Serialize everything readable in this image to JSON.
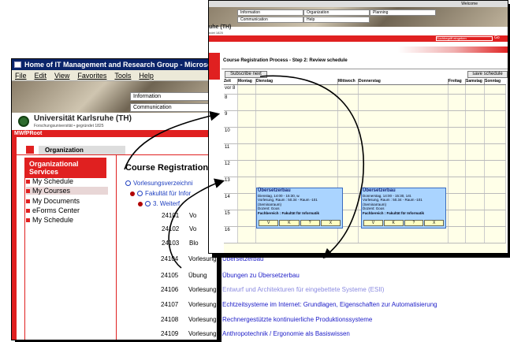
{
  "win_a": {
    "title": "Home of IT Management and Research Group - Microsoft Internet E",
    "menu": [
      "File",
      "Edit",
      "View",
      "Favorites",
      "Tools",
      "Help"
    ],
    "nav_fields": [
      "Information",
      "Communication"
    ],
    "university": "Universität Karlsruhe (TH)",
    "university_sub": "Forschungsuniversität • gegründet 1825",
    "root_label": "MWfPRoot",
    "sidebar_title": "Organization",
    "sidebar_section": "Organizational Services",
    "sidebar_items": [
      "My Schedule",
      "My Courses",
      "My Documents",
      "eForms Center",
      "My Schedule"
    ],
    "content_title": "Course Registration P",
    "tree": [
      "Vorlesungsverzeichni",
      "Fakultät für Infor",
      "3. Weiterf"
    ],
    "courses": [
      {
        "num": "24101",
        "type": "Vo",
        "title": ""
      },
      {
        "num": "24102",
        "type": "Vo",
        "title": ""
      },
      {
        "num": "24103",
        "type": "Blo",
        "title": ""
      },
      {
        "num": "24104",
        "type": "Vorlesung",
        "title": "Übersetzerbau"
      },
      {
        "num": "24105",
        "type": "Übung",
        "title": "Übungen zu Übersetzerbau"
      },
      {
        "num": "24106",
        "type": "Vorlesung",
        "title": "Entwurf und Architekturen für eingebettete Systeme (ESII)"
      },
      {
        "num": "24107",
        "type": "Vorlesung",
        "title": "Echtzeitsysteme im Internet: Grundlagen, Eigenschaften zur Automatisierung"
      },
      {
        "num": "24108",
        "type": "Vorlesung",
        "title": "Rechnergestützte kontinuierliche Produktionssysteme"
      },
      {
        "num": "24109",
        "type": "Vorlesung",
        "title": "Anthropotechnik / Ergonomie als Basiswissen"
      }
    ]
  },
  "win_b": {
    "nav_fields": [
      "Information",
      "Organization",
      "Planning",
      "Communication",
      "Help"
    ],
    "uni_short": "uhe (TH)",
    "uni_short_sub": "ndet 1825",
    "welcome": "Welcome",
    "search_placeholder": "Suchbegriff eingeben",
    "search_button": "Go",
    "heading": "Course Registration Process - Step 2: Review schedule",
    "subscribe_button": "Subscribe next",
    "save_button": "save schedule",
    "columns": [
      "Zeit",
      "Montag",
      "Dienstag",
      "Mittwoch",
      "Donnerstag",
      "Freitag",
      "Samstag",
      "Sonntag"
    ],
    "hours": [
      "vor 8",
      "8",
      "9",
      "10",
      "11",
      "12",
      "13",
      "14",
      "15",
      "16"
    ],
    "events": [
      {
        "title": "Übersetzerbau",
        "line1": "Dienstag, 14:00 - 15:30, w.",
        "line2": "Vorlesung, Raum : 50.34 - Raum -101",
        "line3": "(Seminarraum)",
        "line4": "Dozent: Goos",
        "line5": "Fachbereich : Fakultät für Informatik",
        "actions": [
          "V",
          "K",
          "?",
          "X"
        ]
      },
      {
        "title": "Übersetzerbau",
        "line1": "Donnerstag, 14:00 - 15:30, 14t.",
        "line2": "Vorlesung, Raum : 50.34 - Raum -101",
        "line3": "(Seminarraum)",
        "line4": "Dozent: Goos",
        "line5": "Fachbereich : Fakultät für Informatik",
        "actions": [
          "V",
          "K",
          "?",
          "X"
        ]
      }
    ]
  },
  "colors": {
    "accent_red": "#e02020",
    "title_blue": "#0a246a",
    "event_blue": "#aad4ff",
    "link_blue": "#2020c8"
  }
}
